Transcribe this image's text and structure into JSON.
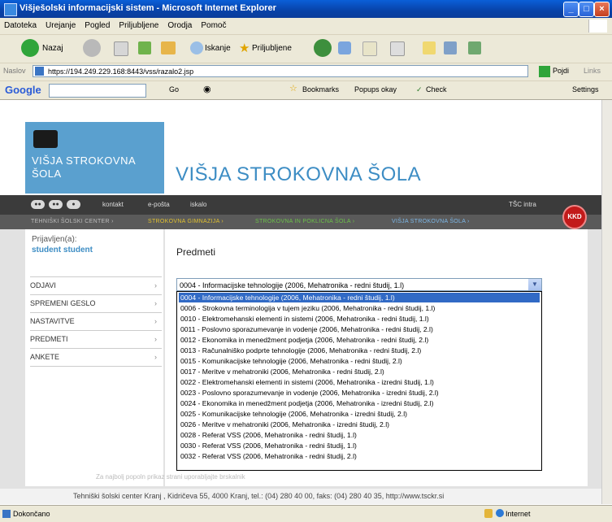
{
  "window": {
    "title": "Višješolski informacijski sistem - Microsoft Internet Explorer"
  },
  "menubar": [
    "Datoteka",
    "Urejanje",
    "Pogled",
    "Priljubljene",
    "Orodja",
    "Pomoč"
  ],
  "toolbar": {
    "back": "Nazaj",
    "search": "Iskanje",
    "favorites": "Priljubljene"
  },
  "address": {
    "label": "Naslov",
    "url": "https://194.249.229.168:8443/vss/razalo2.jsp",
    "go": "Pojdi",
    "links": "Links"
  },
  "googlebar": {
    "brand": "Google",
    "go": "Go",
    "bookmarks": "Bookmarks",
    "popups": "Popups okay",
    "check": "Check",
    "settings": "Settings"
  },
  "site": {
    "logo_line1": "VIŠJA STROKOVNA",
    "logo_line2": "ŠOLA",
    "title": "VIŠJA STROKOVNA ŠOLA",
    "nav_links": [
      "kontakt",
      "e-pošta",
      "iskalo"
    ],
    "nav_right": "TŠC intra",
    "badge": "KKD",
    "subnav": [
      "TEHNIŠKI ŠOLSKI CENTER ›",
      "STROKOVNA GIMNAZIJA ›",
      "STROKOVNA IN POKLICNA ŠOLA ›",
      "VIŠJA STROKOVNA ŠOLA ›"
    ]
  },
  "sidebar": {
    "logged_label": "Prijavljen(a):",
    "user": "student student",
    "items": [
      "ODJAVI",
      "SPREMENI GESLO",
      "NASTAVITVE",
      "PREDMETI",
      "ANKETE"
    ]
  },
  "main": {
    "title": "Predmeti",
    "selected": "0004 - Informacijske tehnologije (2006, Mehatronika - redni študij, 1.l)",
    "options": [
      "0004 - Informacijske tehnologije (2006, Mehatronika - redni študij, 1.l)",
      "0006 - Strokovna terminologija v tujem jeziku (2006, Mehatronika - redni študij, 1.l)",
      "0010 - Elektromehanski elementi in sistemi (2006, Mehatronika - redni študij, 1.l)",
      "0011 - Poslovno sporazumevanje in vodenje (2006, Mehatronika - redni študij, 2.l)",
      "0012 - Ekonomika in menedžment podjetja (2006, Mehatronika - redni študij, 2.l)",
      "0013 - Računalniško podprte tehnologije (2006, Mehatronika - redni študij, 2.l)",
      "0015 - Komunikacijske tehnologije (2006, Mehatronika - redni študij, 2.l)",
      "0017 - Meritve v mehatroniki (2006, Mehatronika - redni študij, 2.l)",
      "0022 - Elektromehanski elementi in sistemi (2006, Mehatronika - izredni študij, 1.l)",
      "0023 - Poslovno sporazumevanje in vodenje (2006, Mehatronika - izredni študij, 2.l)",
      "0024 - Ekonomika in menedžment podjetja (2006, Mehatronika - izredni študij, 2.l)",
      "0025 - Komunikacijske tehnologije (2006, Mehatronika - izredni študij, 2.l)",
      "0026 - Meritve v mehatroniki (2006, Mehatronika - izredni študij, 2.l)",
      "0028 - Referat VSS (2006, Mehatronika - redni študij, 1.l)",
      "0030 - Referat VSS (2006, Mehatronika - redni študij, 1.l)",
      "0032 - Referat VSS (2006, Mehatronika - redni študij, 2.l)"
    ]
  },
  "footnote": "Za najbolj popoln prikaz strani uporabljajte brskalnik",
  "footer": "Tehniški šolski center Kranj , Kidričeva 55, 4000 Kranj, tel.: (04) 280 40 00, faks: (04) 280 40 35, http://www.tsckr.si",
  "status": {
    "text": "Dokončano",
    "zone": "Internet"
  }
}
